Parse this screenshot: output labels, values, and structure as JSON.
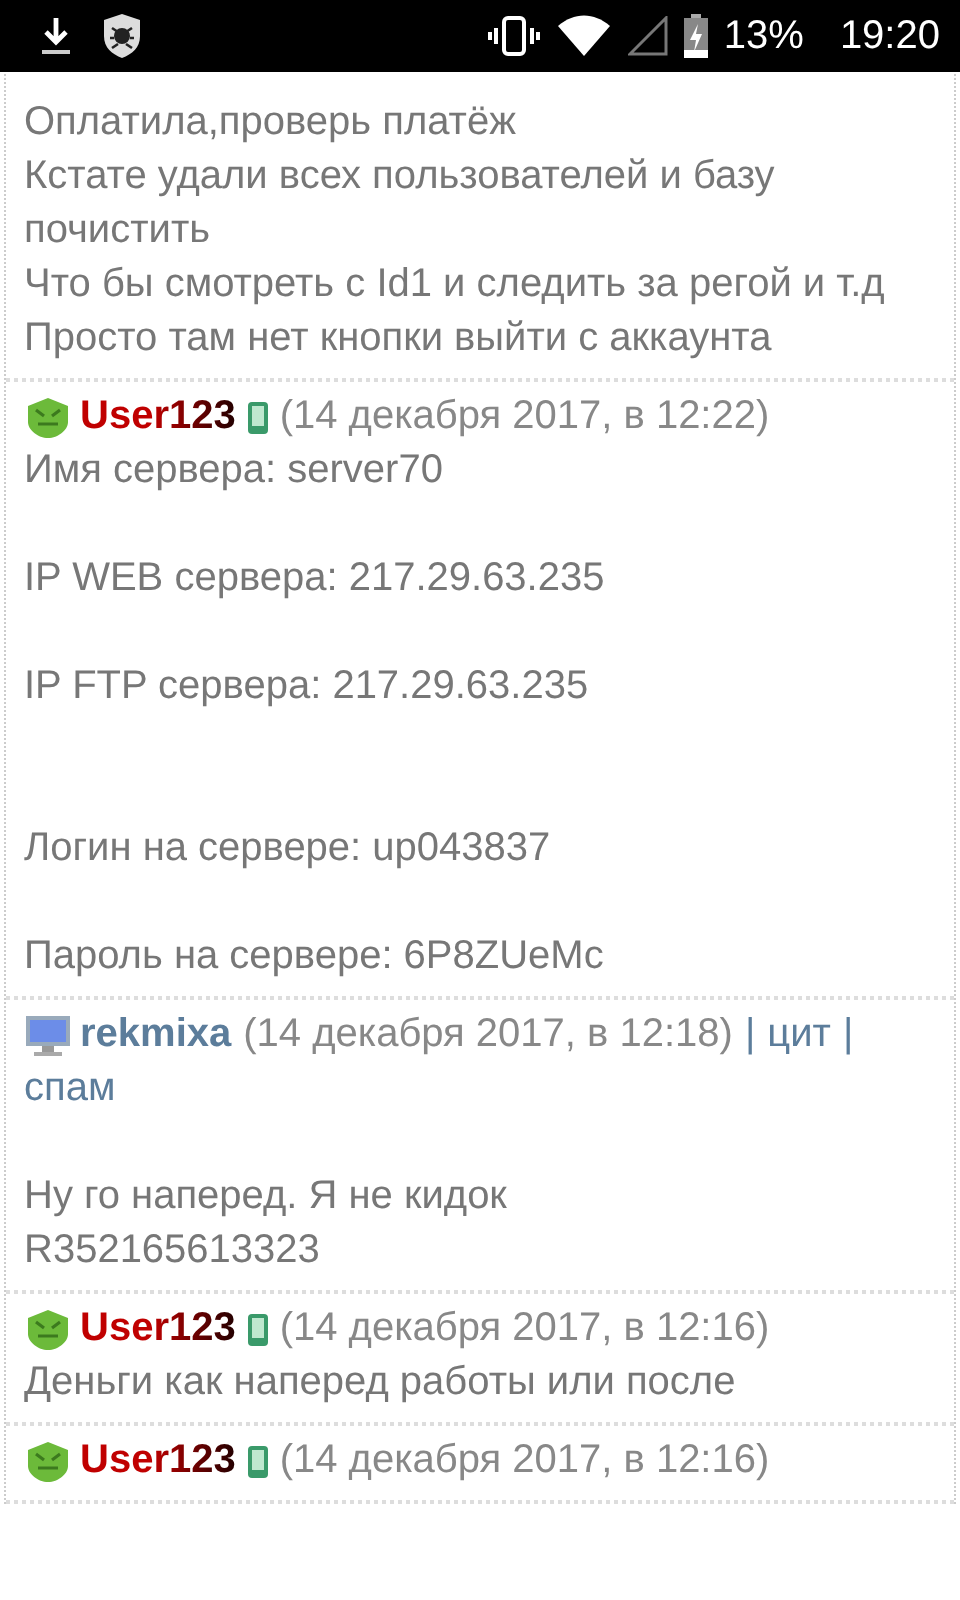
{
  "status_bar": {
    "battery": "13%",
    "time": "19:20"
  },
  "posts": [
    {
      "lines": [
        {
          "kind": "text",
          "text": "Оплатила,проверь платёж"
        },
        {
          "kind": "text",
          "text": "Кстате удали всех пользователей и базу почистить"
        },
        {
          "kind": "text",
          "text": "Что бы смотреть с Id1 и следить за регой и т.д"
        },
        {
          "kind": "text",
          "text": "Просто там нет кнопки выйти с аккаунта"
        }
      ]
    },
    {
      "kind": "mobile",
      "author": "User123",
      "time": "(14 декабря 2017, в 12:22)",
      "lines": [
        {
          "kind": "text",
          "text": "Имя сервера: server70"
        },
        {
          "kind": "blank"
        },
        {
          "kind": "text",
          "text": "IP WEB сервера: 217.29.63.235"
        },
        {
          "kind": "blank"
        },
        {
          "kind": "text",
          "text": "IP FTP сервера: 217.29.63.235"
        },
        {
          "kind": "blank"
        },
        {
          "kind": "blank"
        },
        {
          "kind": "text",
          "text": "Логин на сервере: up043837"
        },
        {
          "kind": "blank"
        },
        {
          "kind": "text",
          "text": "Пароль на сервере: 6P8ZUeMc"
        }
      ]
    },
    {
      "kind": "desktop",
      "author": "rekmixa",
      "time": "(14 декабря 2017, в 12:18)",
      "links": [
        {
          "separator": "|",
          "text": "цит"
        },
        {
          "separator": "|",
          "text": "спам"
        }
      ],
      "lines": [
        {
          "kind": "blank"
        },
        {
          "kind": "text",
          "text": "Ну го наперед. Я не кидок"
        },
        {
          "kind": "text",
          "text": "R352165613323"
        }
      ]
    },
    {
      "kind": "mobile",
      "author": "User123",
      "time": "(14 декабря 2017, в 12:16)",
      "lines": [
        {
          "kind": "text",
          "text": "Деньги как наперед работы или после"
        }
      ]
    },
    {
      "kind": "mobile",
      "author": "User123",
      "time": "(14 декабря 2017, в 12:16)"
    }
  ]
}
